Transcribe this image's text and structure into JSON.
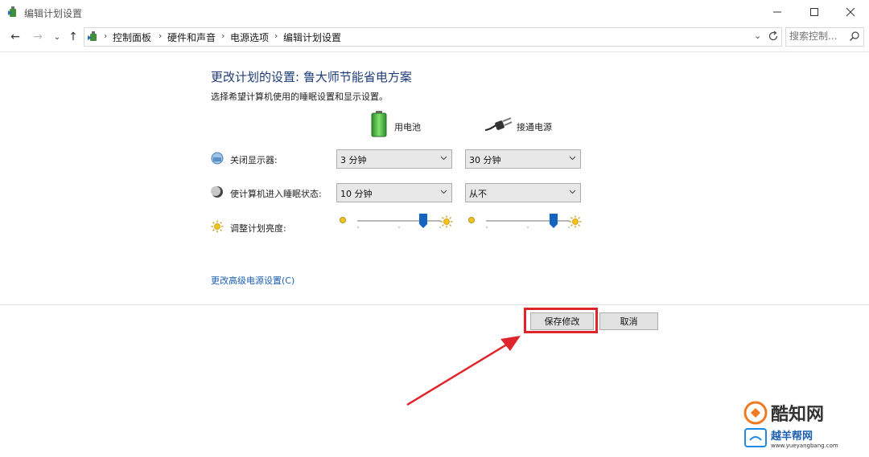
{
  "window": {
    "title": "编辑计划设置"
  },
  "nav": {
    "breadcrumbs": [
      "控制面板",
      "硬件和声音",
      "电源选项",
      "编辑计划设置"
    ],
    "search_placeholder": "搜索控制..."
  },
  "content": {
    "heading": "更改计划的设置: 鲁大师节能省电方案",
    "subheading": "选择希望计算机使用的睡眠设置和显示设置。",
    "columns": {
      "battery": "用电池",
      "plugged": "接通电源"
    },
    "rows": [
      {
        "label": "关闭显示器:",
        "icon": "display-icon",
        "battery": "3 分钟",
        "plugged": "30 分钟"
      },
      {
        "label": "使计算机进入睡眠状态:",
        "icon": "moon-icon",
        "battery": "10 分钟",
        "plugged": "从不"
      },
      {
        "label": "调整计划亮度:",
        "icon": "sun-icon"
      }
    ],
    "brightness": {
      "battery": 0.82,
      "plugged": 0.84
    },
    "advanced_link": "更改高级电源设置(C)"
  },
  "footer": {
    "save": "保存修改",
    "cancel": "取消"
  },
  "colors": {
    "heading": "#1e3c78",
    "link": "#1a5fb4",
    "thumb": "#1565c0",
    "highlight": "#e0242c"
  },
  "watermark": {
    "site1": "酷知网",
    "site2": "越羊帮网",
    "url": "www.yueyangbang.com"
  }
}
